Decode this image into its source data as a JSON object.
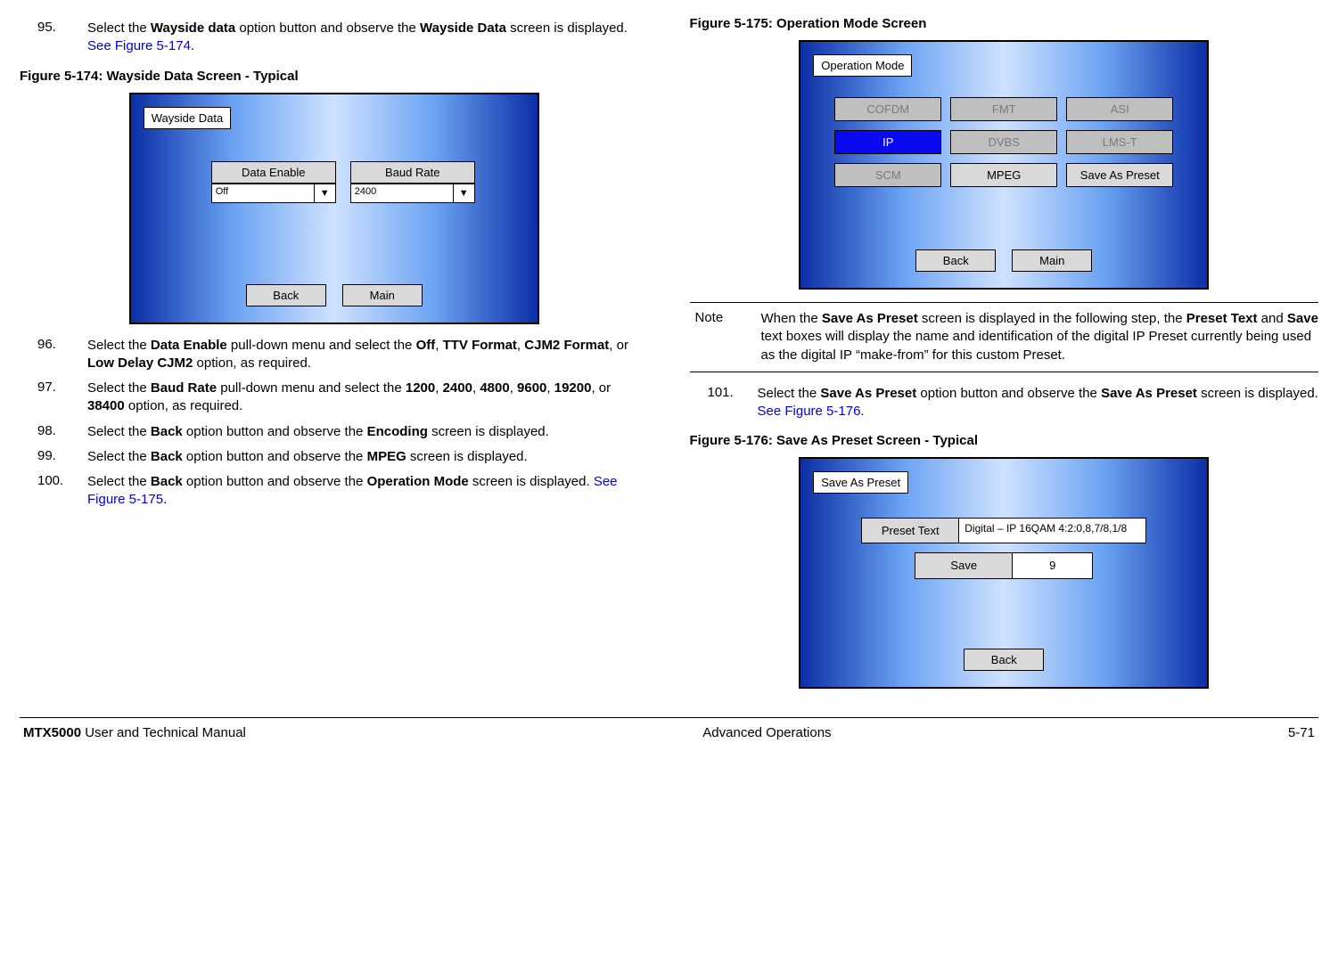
{
  "left": {
    "step95": {
      "num": "95.",
      "t1": "Select the ",
      "b1": "Wayside data",
      "t2": " option button and observe the ",
      "b2": "Wayside Data",
      "t3": " screen is displayed.  ",
      "link": "See Figure 5-174",
      "t4": "."
    },
    "fig174_caption": "Figure 5-174:   Wayside Data Screen - Typical",
    "fig174": {
      "title": "Wayside Data",
      "data_enable_label": "Data Enable",
      "baud_rate_label": "Baud Rate",
      "data_enable_value": "Off",
      "baud_rate_value": "2400",
      "back": "Back",
      "main": "Main"
    },
    "step96": {
      "num": "96.",
      "t1": "Select the ",
      "b1": "Data Enable",
      "t2": " pull-down menu and select the ",
      "b2": "Off",
      "t3": ", ",
      "b3": "TTV Format",
      "t4": ", ",
      "b4": "CJM2 Format",
      "t5": ", or ",
      "b5": "Low Delay CJM2",
      "t6": " option, as required."
    },
    "step97": {
      "num": "97.",
      "t1": "Select the ",
      "b1": "Baud Rate",
      "t2": " pull-down menu and select the ",
      "b2": "1200",
      "t3": ", ",
      "b3": "2400",
      "t4": ", ",
      "b4": "4800",
      "t5": ", ",
      "b5": "9600",
      "t6": ", ",
      "b6": "19200",
      "t7": ", or ",
      "b7": "38400",
      "t8": " option, as required."
    },
    "step98": {
      "num": "98.",
      "t1": "Select the ",
      "b1": "Back",
      "t2": " option button and observe the ",
      "b2": "Encoding",
      "t3": " screen is displayed."
    },
    "step99": {
      "num": "99.",
      "t1": "Select the ",
      "b1": "Back",
      "t2": " option button and observe the ",
      "b2": "MPEG",
      "t3": " screen is displayed."
    },
    "step100": {
      "num": "100.",
      "t1": "Select the ",
      "b1": "Back",
      "t2": " option button and observe the ",
      "b2": "Operation Mode",
      "t3": " screen is displayed.  ",
      "link": "See Figure 5-175",
      "t4": "."
    }
  },
  "right": {
    "fig175_caption": "Figure 5-175:   Operation Mode Screen",
    "fig175": {
      "title": "Operation Mode",
      "cofdm": "COFDM",
      "fmt": "FMT",
      "asi": "ASI",
      "ip": "IP",
      "dvbs": "DVBS",
      "lmst": "LMS-T",
      "scm": "SCM",
      "mpeg": "MPEG",
      "save_as_preset": "Save As Preset",
      "back": "Back",
      "main": "Main"
    },
    "note": {
      "label": "Note",
      "t1": "When the ",
      "b1": "Save As Preset",
      "t2": " screen is displayed in the following step, the ",
      "b2": "Preset Text",
      "t3": " and ",
      "b3": "Save",
      "t4": " text boxes will display the name and identification of the digital IP Preset currently being used as the digital IP “make-from” for this custom Preset."
    },
    "step101": {
      "num": "101.",
      "t1": "Select the ",
      "b1": "Save As Preset",
      "t2": " option button and observe the ",
      "b2": "Save As Preset",
      "t3": " screen is displayed.  ",
      "link": "See Figure 5-176",
      "t4": "."
    },
    "fig176_caption": "Figure 5-176:   Save As Preset Screen - Typical",
    "fig176": {
      "title": "Save As Preset",
      "preset_text_label": "Preset Text",
      "preset_text_value": "Digital – IP 16QAM 4:2:0,8,7/8,1/8",
      "save_label": "Save",
      "save_value": "9",
      "back": "Back"
    }
  },
  "footer": {
    "left_b": "MTX5000",
    "left_t": " User and Technical Manual",
    "center": "Advanced Operations ",
    "right": "5-71"
  }
}
